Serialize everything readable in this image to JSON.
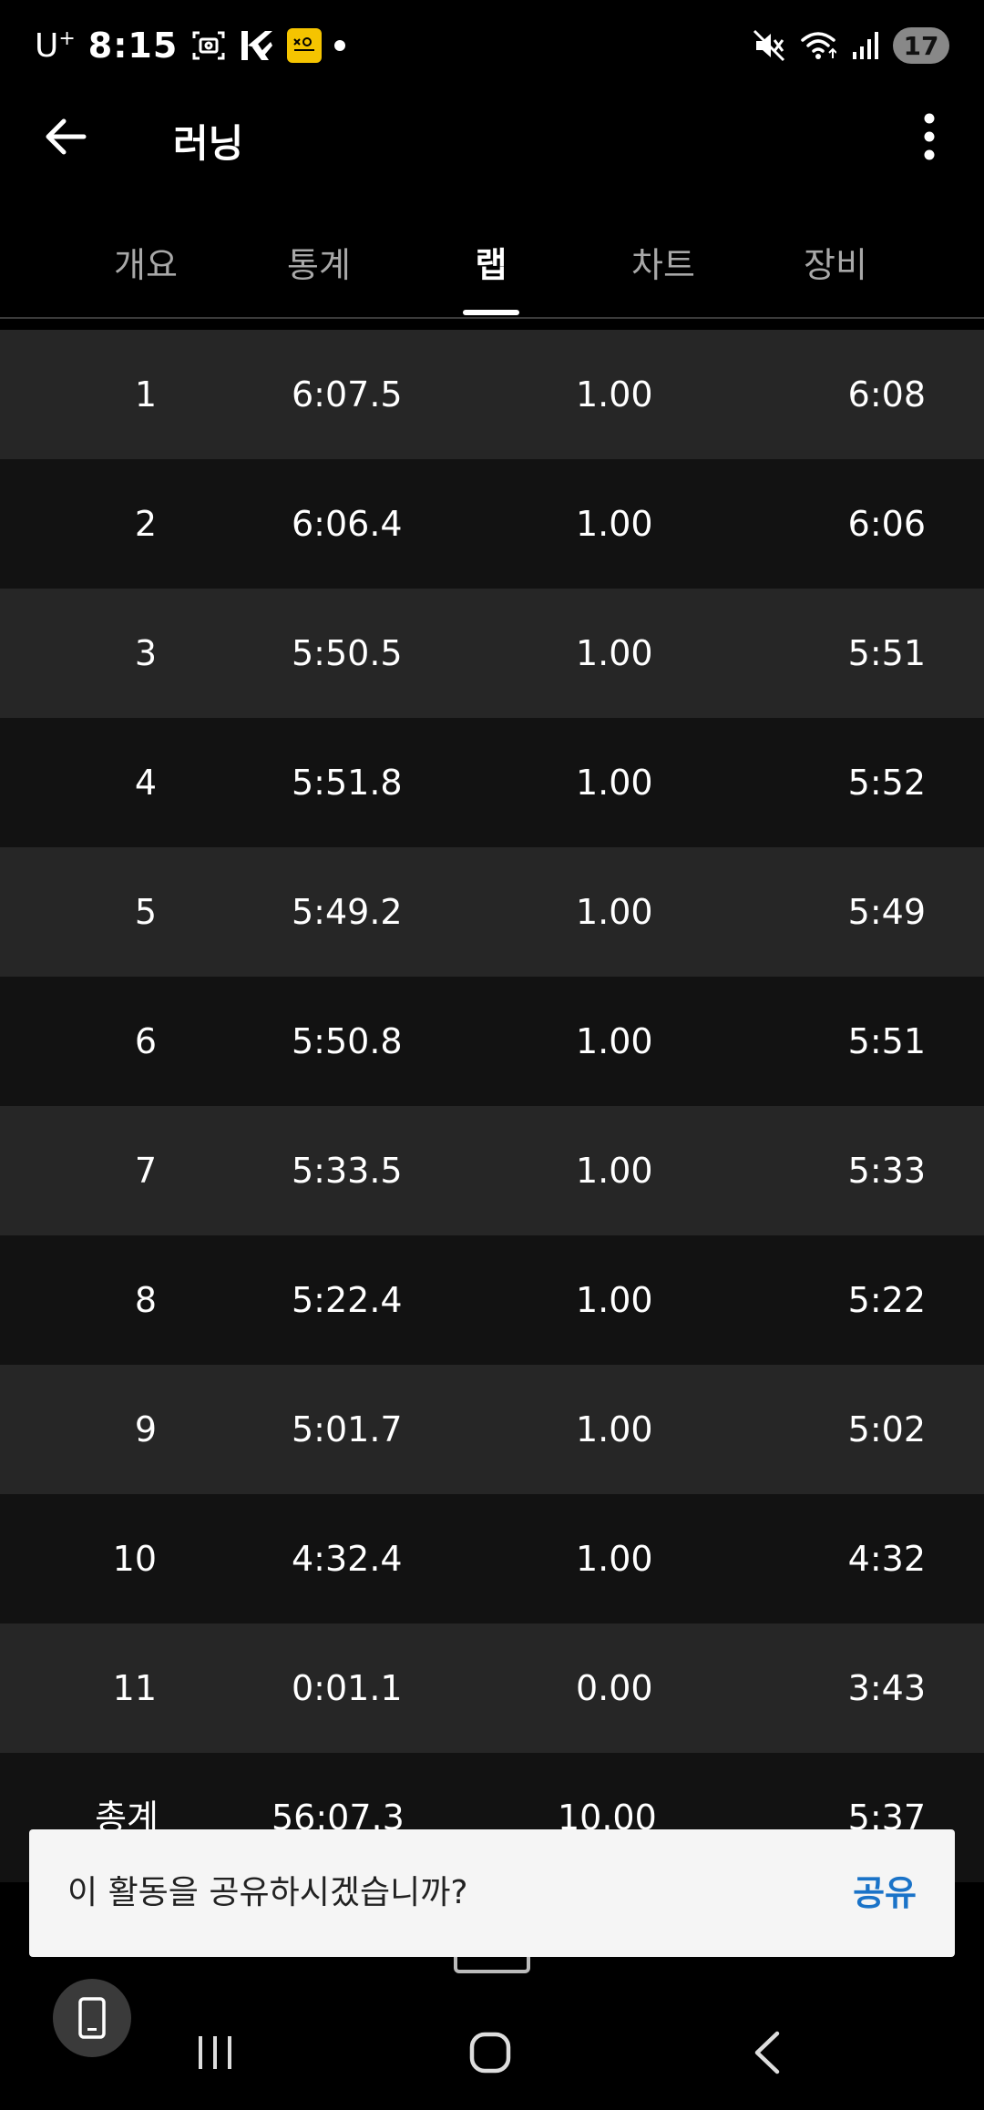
{
  "status_bar": {
    "carrier": "U",
    "carrier_sup": "+",
    "time": "8:15",
    "battery": "17",
    "icons": [
      "screenshot-icon",
      "k-app-icon",
      "kakao-badge-icon",
      "notification-dot-icon",
      "mute-icon",
      "wifi-icon",
      "signal-icon",
      "battery-icon"
    ]
  },
  "app_bar": {
    "title": "러닝"
  },
  "tabs": [
    {
      "label": "개요",
      "active": false
    },
    {
      "label": "통계",
      "active": false
    },
    {
      "label": "랩",
      "active": true
    },
    {
      "label": "차트",
      "active": false
    },
    {
      "label": "장비",
      "active": false
    }
  ],
  "laps": [
    {
      "lap": "1",
      "time": "6:07.5",
      "distance": "1.00",
      "pace": "6:08"
    },
    {
      "lap": "2",
      "time": "6:06.4",
      "distance": "1.00",
      "pace": "6:06"
    },
    {
      "lap": "3",
      "time": "5:50.5",
      "distance": "1.00",
      "pace": "5:51"
    },
    {
      "lap": "4",
      "time": "5:51.8",
      "distance": "1.00",
      "pace": "5:52"
    },
    {
      "lap": "5",
      "time": "5:49.2",
      "distance": "1.00",
      "pace": "5:49"
    },
    {
      "lap": "6",
      "time": "5:50.8",
      "distance": "1.00",
      "pace": "5:51"
    },
    {
      "lap": "7",
      "time": "5:33.5",
      "distance": "1.00",
      "pace": "5:33"
    },
    {
      "lap": "8",
      "time": "5:22.4",
      "distance": "1.00",
      "pace": "5:22"
    },
    {
      "lap": "9",
      "time": "5:01.7",
      "distance": "1.00",
      "pace": "5:02"
    },
    {
      "lap": "10",
      "time": "4:32.4",
      "distance": "1.00",
      "pace": "4:32"
    },
    {
      "lap": "11",
      "time": "0:01.1",
      "distance": "0.00",
      "pace": "3:43"
    }
  ],
  "total": {
    "lap": "총계",
    "time": "56:07.3",
    "distance": "10.00",
    "pace": "5:37"
  },
  "snackbar": {
    "message": "이 활동을 공유하시겠습니까?",
    "action": "공유"
  }
}
